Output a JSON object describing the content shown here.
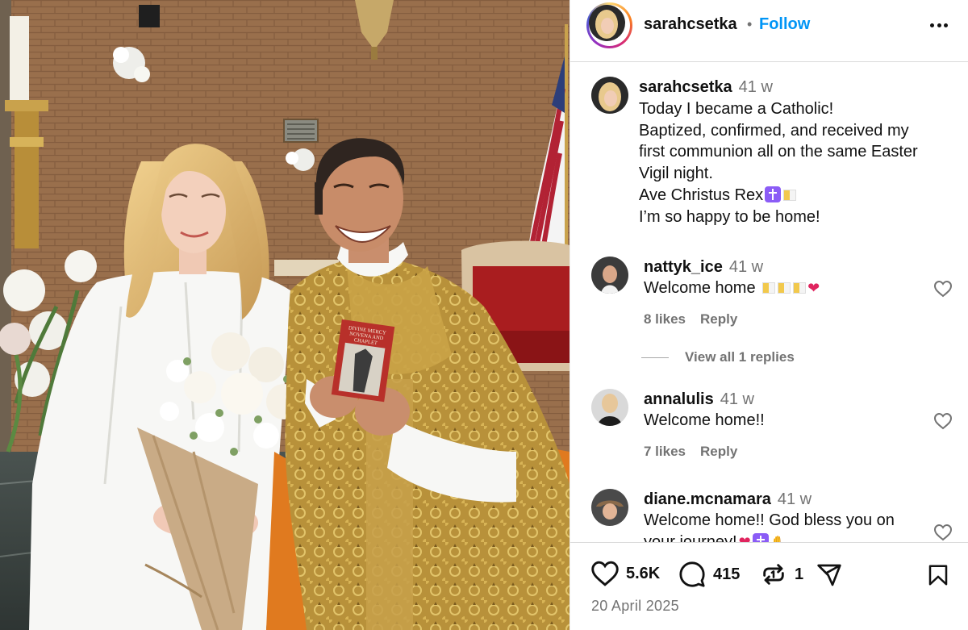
{
  "post": {
    "author": "sarahcsetka",
    "follow_separator": "•",
    "follow_label": "Follow",
    "photo_alt": "Post photo",
    "book_title_lines": [
      "DIVINE MERCY",
      "NOVENA AND",
      "CHAPLET"
    ]
  },
  "caption": {
    "author": "sarahcsetka",
    "time": "41 w",
    "lines": [
      "Today I became a Catholic!",
      "Baptized, confirmed, and received my",
      "first communion all on the same Easter",
      "Vigil night.",
      "Ave Christus Rex",
      "I’m so happy to be home!"
    ]
  },
  "comments": [
    {
      "author": "nattyk_ice",
      "time": "41 w",
      "text": "Welcome home",
      "likes": "8 likes",
      "reply_label": "Reply"
    },
    {
      "author": "annalulis",
      "time": "41 w",
      "text": "Welcome home!!",
      "likes": "7 likes",
      "reply_label": "Reply"
    },
    {
      "author": "diane.mcnamara",
      "time": "41 w",
      "text": "Welcome home!! God bless you on",
      "text2": "your journey!"
    }
  ],
  "view_replies": "View all 1 replies",
  "actions": {
    "likes": "5.6K",
    "comments": "415",
    "reposts": "1"
  },
  "date": "20 April 2025",
  "icons": [
    "heart-icon",
    "comment-icon",
    "repost-icon",
    "share-icon",
    "bookmark-icon",
    "more-icon"
  ],
  "colors": {
    "accent": "#0095f6",
    "muted": "#737373",
    "divider": "#dbdbdb"
  }
}
